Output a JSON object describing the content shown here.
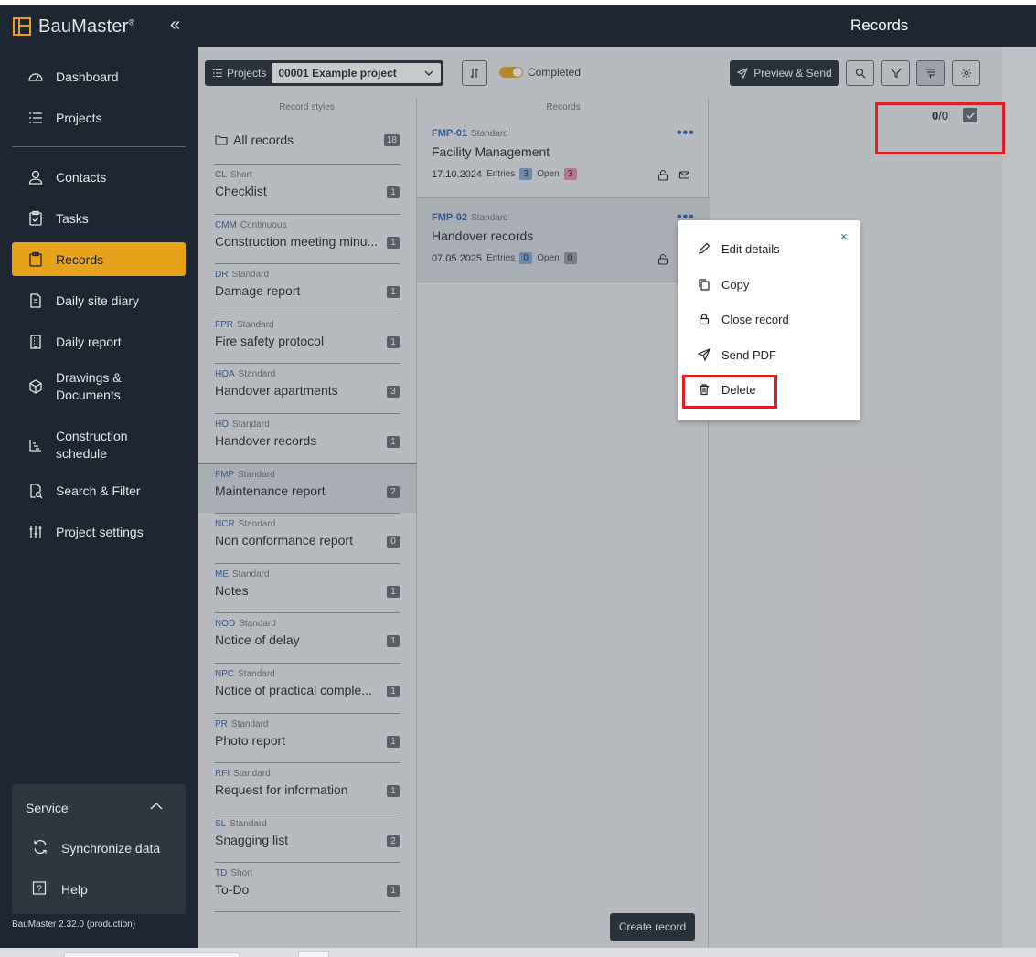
{
  "app": {
    "brand": "BauMaster",
    "brand_mark": "®",
    "collapse": "«",
    "version": "BauMaster 2.32.0 (production)"
  },
  "header": {
    "title": "Records"
  },
  "sidebar": {
    "items": [
      {
        "label": "Dashboard",
        "icon": "dashboard-icon"
      },
      {
        "label": "Projects",
        "icon": "list-icon"
      },
      {
        "label": "Contacts",
        "icon": "user-icon"
      },
      {
        "label": "Tasks",
        "icon": "clipboard-check-icon"
      },
      {
        "label": "Records",
        "icon": "clipboard-icon",
        "active": true
      },
      {
        "label": "Daily site diary",
        "icon": "document-icon"
      },
      {
        "label": "Daily report",
        "icon": "building-icon"
      },
      {
        "label": "Drawings & Documents",
        "icon": "cube-icon"
      },
      {
        "label": "Construction schedule",
        "icon": "gantt-icon"
      },
      {
        "label": "Search & Filter",
        "icon": "search-document-icon"
      },
      {
        "label": "Project settings",
        "icon": "sliders-icon"
      }
    ],
    "service": {
      "label": "Service",
      "items": [
        {
          "label": "Synchronize data",
          "icon": "sync-icon"
        },
        {
          "label": "Help",
          "icon": "help-icon"
        }
      ]
    }
  },
  "toolbar": {
    "projects_label": "Projects",
    "project_value": "00001 Example project",
    "completed_label": "Completed",
    "preview_send_label": "Preview & Send"
  },
  "styles_column": {
    "caption": "Record styles",
    "all_records_label": "All records",
    "all_records_count": "18",
    "items": [
      {
        "code": "CL",
        "type": "Short",
        "name": "Checklist",
        "count": "1"
      },
      {
        "code": "CMM",
        "type": "Continuous",
        "name": "Construction meeting minu...",
        "count": "1"
      },
      {
        "code": "DR",
        "type": "Standard",
        "name": "Damage report",
        "count": "1"
      },
      {
        "code": "FPR",
        "type": "Standard",
        "name": "Fire safety protocol",
        "count": "1"
      },
      {
        "code": "HOA",
        "type": "Standard",
        "name": "Handover apartments",
        "count": "3"
      },
      {
        "code": "HO",
        "type": "Standard",
        "name": "Handover records",
        "count": "1"
      },
      {
        "code": "FMP",
        "type": "Standard",
        "name": "Maintenance report",
        "count": "2",
        "selected": true
      },
      {
        "code": "NCR",
        "type": "Standard",
        "name": "Non conformance report",
        "count": "0"
      },
      {
        "code": "ME",
        "type": "Standard",
        "name": "Notes",
        "count": "1"
      },
      {
        "code": "NOD",
        "type": "Standard",
        "name": "Notice of delay",
        "count": "1"
      },
      {
        "code": "NPC",
        "type": "Standard",
        "name": "Notice of practical comple...",
        "count": "1"
      },
      {
        "code": "PR",
        "type": "Standard",
        "name": "Photo report",
        "count": "1"
      },
      {
        "code": "RFI",
        "type": "Standard",
        "name": "Request for information",
        "count": "1"
      },
      {
        "code": "SL",
        "type": "Standard",
        "name": "Snagging list",
        "count": "2"
      },
      {
        "code": "TD",
        "type": "Short",
        "name": "To-Do",
        "count": "1"
      }
    ]
  },
  "records_column": {
    "caption": "Records",
    "entries_label": "Entries",
    "open_label": "Open",
    "create_label": "Create record",
    "items": [
      {
        "code": "FMP-01",
        "type": "Standard",
        "title": "Facility Management",
        "date": "17.10.2024",
        "entries": "3",
        "open": "3"
      },
      {
        "code": "FMP-02",
        "type": "Standard",
        "title": "Handover records",
        "date": "07.05.2025",
        "entries": "0",
        "open": "0",
        "selected": true
      }
    ]
  },
  "selection": {
    "selected": "0",
    "separator": "/",
    "total": "0"
  },
  "context_menu": {
    "close": "×",
    "items": [
      {
        "label": "Edit details",
        "icon": "pencil-icon"
      },
      {
        "label": "Copy",
        "icon": "copy-icon"
      },
      {
        "label": "Close record",
        "icon": "lock-icon"
      },
      {
        "label": "Send PDF",
        "icon": "send-icon"
      },
      {
        "label": "Delete",
        "icon": "trash-icon"
      }
    ]
  },
  "colors": {
    "sidebar_bg": "#1e2731",
    "accent": "#e7a21b",
    "link_blue": "#2f5fa8",
    "highlight_red": "#e02020"
  }
}
